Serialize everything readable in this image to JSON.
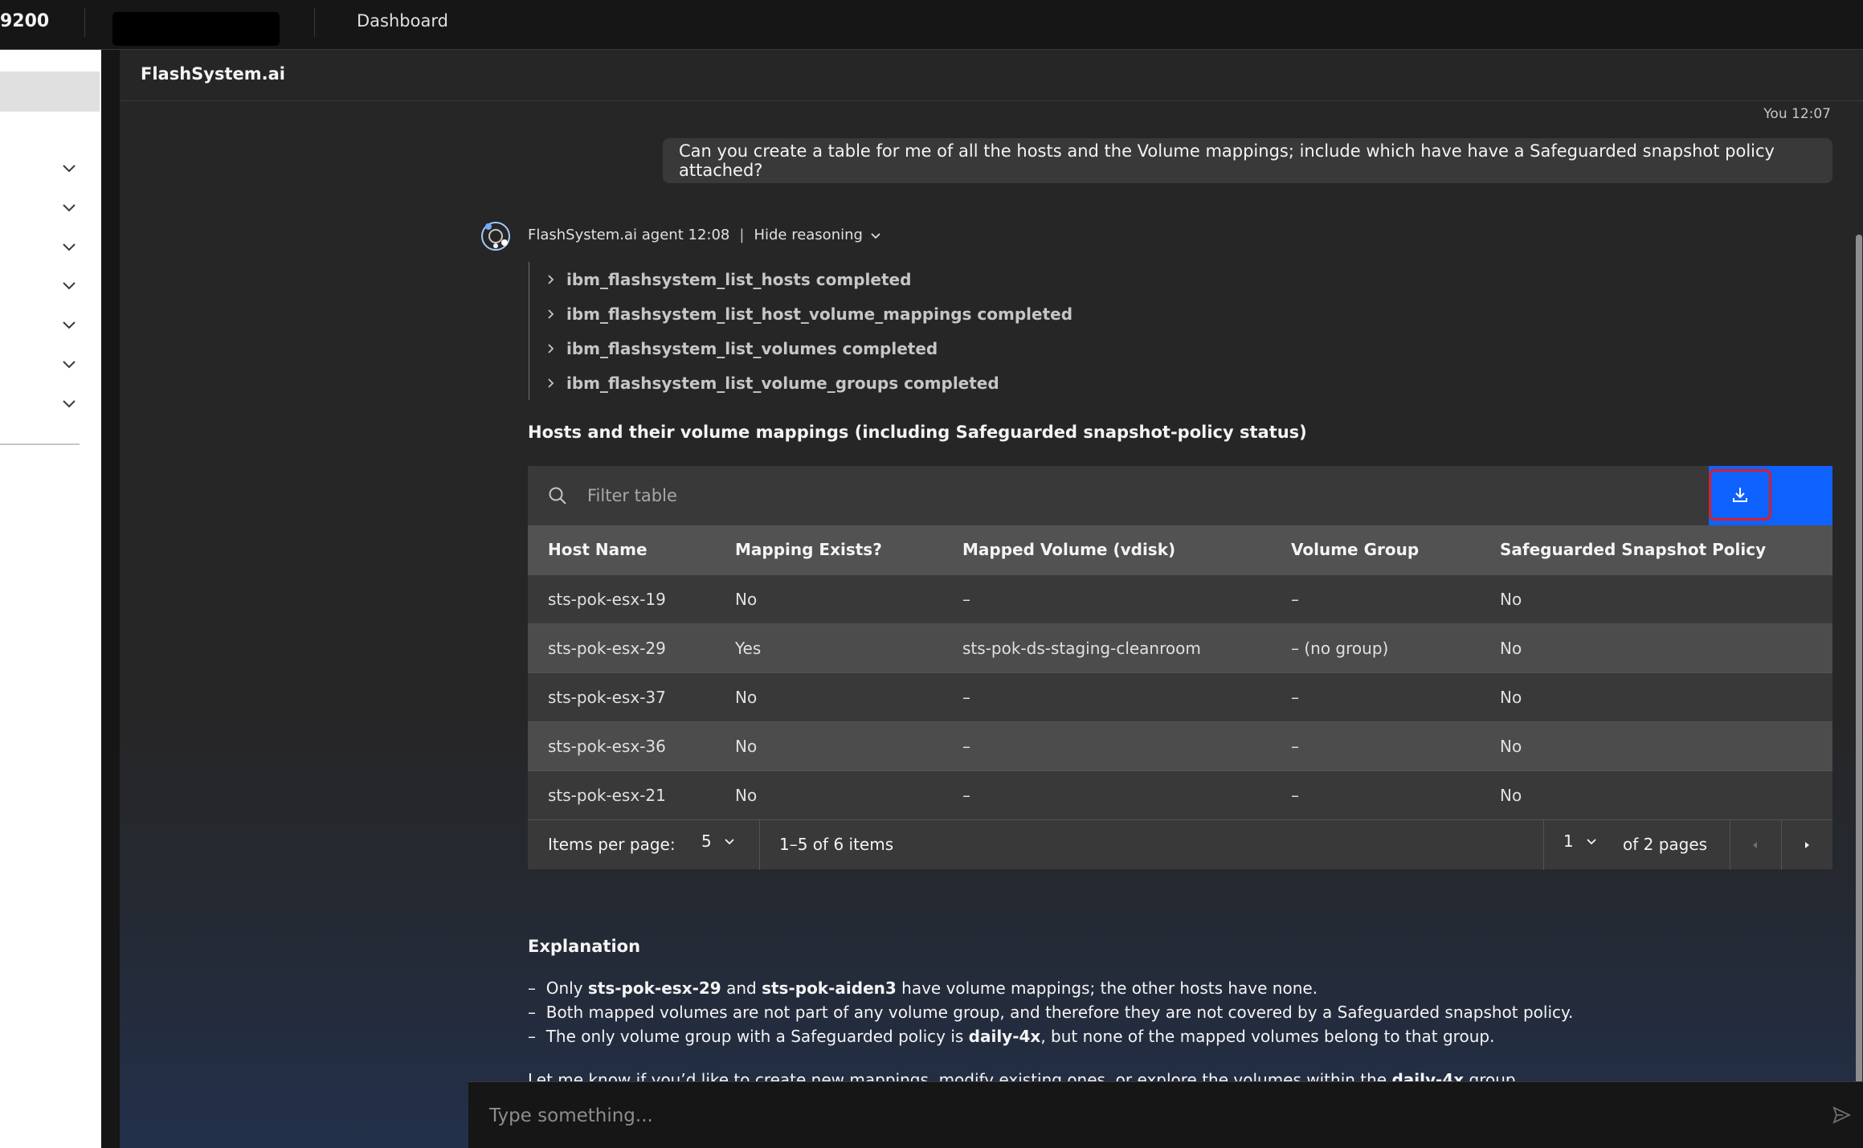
{
  "topbar": {
    "product_number": "9200",
    "dashboard_link": "Dashboard"
  },
  "app": {
    "title": "FlashSystem.ai"
  },
  "conversation": {
    "user_label": "You 12:07",
    "user_message": "Can you create a table for me of all the hosts and the Volume mappings; include which have have a Safeguarded snapshot policy attached?",
    "agent_label": "FlashSystem.ai agent 12:08",
    "meta_separator": "|",
    "hide_reasoning": "Hide reasoning",
    "reasoning_steps": [
      "ibm_flashsystem_list_hosts completed",
      "ibm_flashsystem_list_host_volume_mappings completed",
      "ibm_flashsystem_list_volumes completed",
      "ibm_flashsystem_list_volume_groups completed"
    ]
  },
  "table": {
    "title": "Hosts and their volume mappings (including Safeguarded snapshot-policy status)",
    "filter_placeholder": "Filter table",
    "columns": [
      "Host Name",
      "Mapping Exists?",
      "Mapped Volume (vdisk)",
      "Volume Group",
      "Safeguarded Snapshot Policy"
    ],
    "rows": [
      [
        "sts-pok-esx-19",
        "No",
        "–",
        "–",
        "No"
      ],
      [
        "sts-pok-esx-29",
        "Yes",
        "sts-pok-ds-staging-cleanroom",
        "– (no group)",
        "No"
      ],
      [
        "sts-pok-esx-37",
        "No",
        "–",
        "–",
        "No"
      ],
      [
        "sts-pok-esx-36",
        "No",
        "–",
        "–",
        "No"
      ],
      [
        "sts-pok-esx-21",
        "No",
        "–",
        "–",
        "No"
      ]
    ],
    "pagination": {
      "items_per_page_label": "Items per page:",
      "items_per_page": "5",
      "range_text": "1–5 of 6 items",
      "current_page": "1",
      "of_pages_text": "of 2 pages"
    }
  },
  "explanation": {
    "heading": "Explanation",
    "dash": "–",
    "line1": {
      "a": "Only ",
      "b": "sts-pok-esx-29",
      "c": " and ",
      "d": "sts-pok-aiden3",
      "e": " have volume mappings; the other hosts have none."
    },
    "line2": "Both mapped volumes are not part of any volume group, and therefore they are not covered by a Safeguarded snapshot policy.",
    "line3": {
      "a": "The only volume group with a Safeguarded policy is ",
      "b": "daily-4x",
      "c": ", but none of the mapped volumes belong to that group."
    },
    "closing": {
      "a": "Let me know if you’d like to create new mappings, modify existing ones, or explore the volumes within the ",
      "b": "daily-4x",
      "c": " group."
    }
  },
  "composer": {
    "placeholder": "Type something..."
  },
  "colors": {
    "accent": "#0f62fe",
    "highlight": "#da1e28",
    "background": "#262626"
  }
}
